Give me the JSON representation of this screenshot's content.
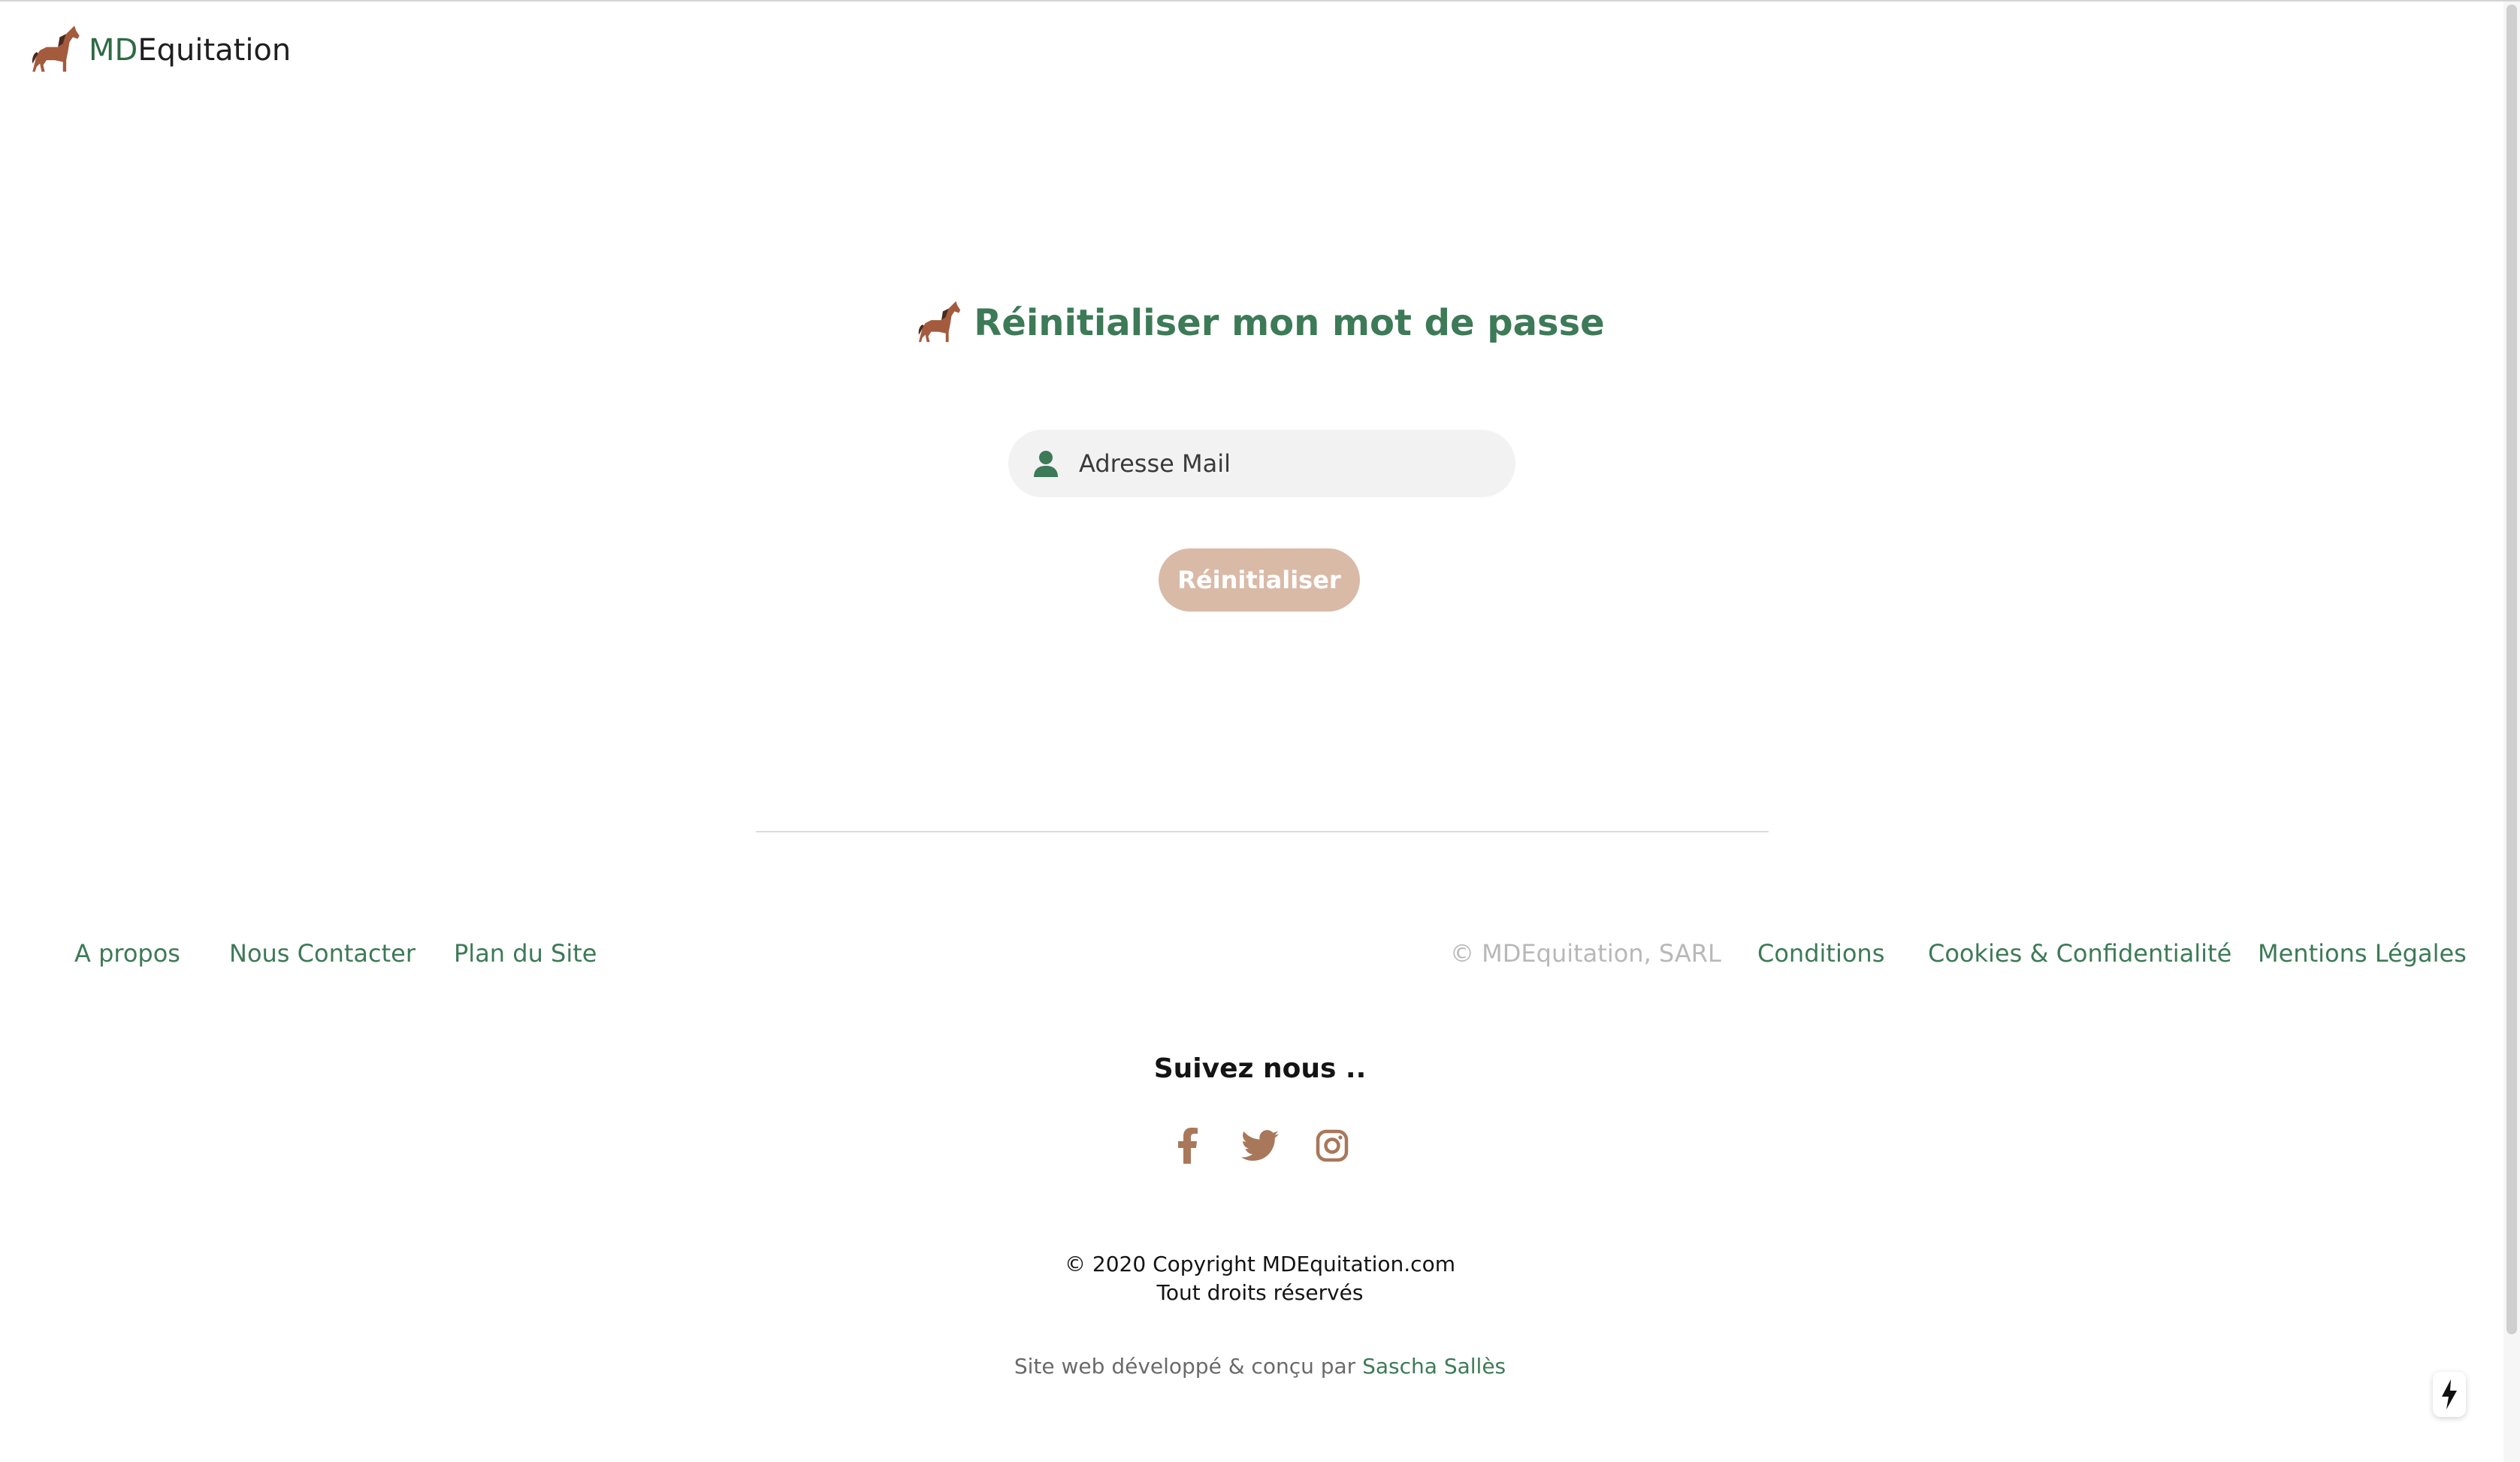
{
  "header": {
    "brand_prefix": "MD",
    "brand_suffix": "Equitation",
    "logo_icon": "horse-icon"
  },
  "main": {
    "title": "Réinitialiser mon mot de passe",
    "email_placeholder": "Adresse Mail",
    "email_value": "",
    "submit_label": "Réinitialiser"
  },
  "footer": {
    "links_left": [
      "A propos",
      "Nous Contacter",
      "Plan du Site"
    ],
    "company": "© MDEquitation, SARL",
    "links_right": [
      "Conditions",
      "Cookies & Confidentialité",
      "Mentions Légales"
    ],
    "follow_title": "Suivez nous ..",
    "socials": [
      "facebook-icon",
      "twitter-icon",
      "instagram-icon"
    ],
    "copyright_line1": "© 2020 Copyright MDEquitation.com",
    "copyright_line2": "Tout droits réservés",
    "credit_prefix": "Site web développé & conçu par",
    "credit_author": "Sascha Sallès"
  },
  "colors": {
    "accent_green": "#3d7a57",
    "button_tan": "#d9baa7",
    "social_brown": "#a9775a"
  }
}
